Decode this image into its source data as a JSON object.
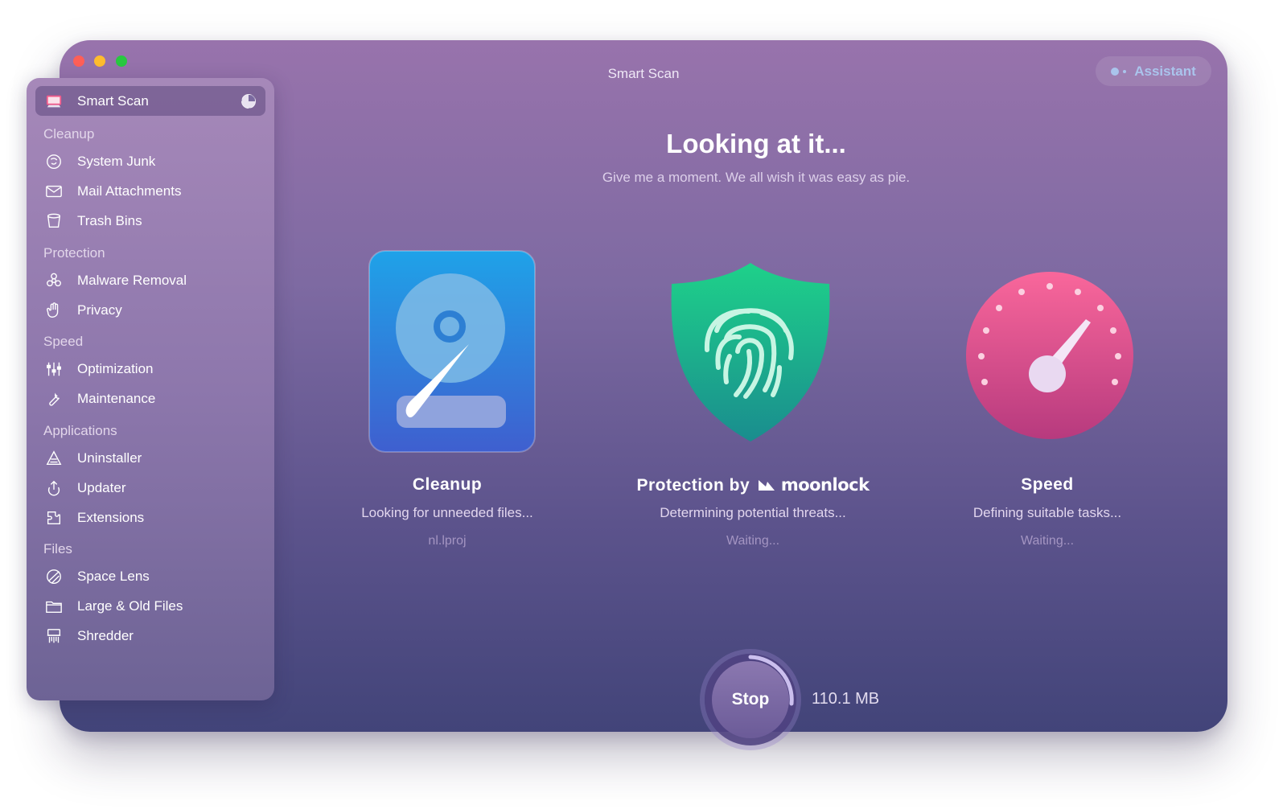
{
  "window": {
    "title": "Smart Scan",
    "assistant_label": "Assistant"
  },
  "sidebar": {
    "active_item": "Smart Scan",
    "sections": [
      {
        "title": "Cleanup",
        "items": [
          "System Junk",
          "Mail Attachments",
          "Trash Bins"
        ]
      },
      {
        "title": "Protection",
        "items": [
          "Malware Removal",
          "Privacy"
        ]
      },
      {
        "title": "Speed",
        "items": [
          "Optimization",
          "Maintenance"
        ]
      },
      {
        "title": "Applications",
        "items": [
          "Uninstaller",
          "Updater",
          "Extensions"
        ]
      },
      {
        "title": "Files",
        "items": [
          "Space Lens",
          "Large & Old Files",
          "Shredder"
        ]
      }
    ]
  },
  "main": {
    "headline": "Looking at it...",
    "subline": "Give me a moment. We all wish it was easy as pie.",
    "modules": [
      {
        "title": "Cleanup",
        "status": "Looking for unneeded files...",
        "detail": "nl.lproj",
        "icon": "hard-drive-icon"
      },
      {
        "title": "Protection by",
        "brand": "moonlock",
        "status": "Determining potential threats...",
        "detail": "Waiting...",
        "icon": "fingerprint-shield-icon"
      },
      {
        "title": "Speed",
        "status": "Defining suitable tasks...",
        "detail": "Waiting...",
        "icon": "speedometer-icon"
      }
    ],
    "stop_label": "Stop",
    "scanned_size": "110.1 MB"
  },
  "colors": {
    "accent_blue": "#aac4ec",
    "close": "#fe5f57",
    "minimize": "#febc2e",
    "maximize": "#28c840"
  }
}
